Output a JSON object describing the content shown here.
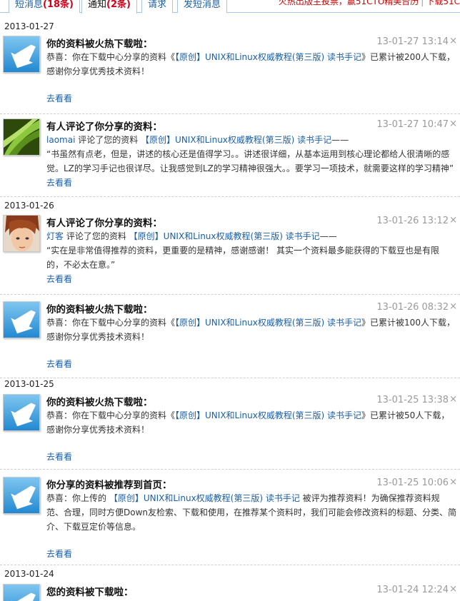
{
  "tabs": {
    "sms_label": "短消息",
    "sms_count": "(18条)",
    "notice_label": "通知",
    "notice_count": "(2条)",
    "request_label": "请求",
    "send_label": "发短消息"
  },
  "top_right": {
    "text1": "火热出版主投票，赢51CTO精美台历",
    "text2": "下载51C"
  },
  "colors": {
    "link": "#1a5fa8",
    "count": "#d0021b",
    "time": "#9a9a9a"
  },
  "dates": [
    "2013-01-27",
    "2013-01-26",
    "2013-01-25",
    "2013-01-24"
  ],
  "items": [
    {
      "avatar": "download-arrow-icon",
      "title": "你的资料被火热下载啦：",
      "time": "13-01-27 13:14",
      "close": "×",
      "body_pre": "恭喜：你在下载中心分享的资料《",
      "link": "【原创】UNIX和Linux权威教程(第三版) 读书手记",
      "body_post": "》已累计被200人下载，感谢你分享优秀技术资料！",
      "more": "去看看"
    },
    {
      "avatar": "green-leaf-avatar",
      "title": "有人评论了你分享的资料：",
      "time": "13-01-27 10:47",
      "close": "×",
      "user": "laomai",
      "action": " 评论了您的资料 ",
      "link": "【原创】UNIX和Linux权威教程(第三版) 读书手记",
      "dash": "——",
      "quote": "“书虽然有点老，但是，讲述的核心还是值得学习。。讲述很详细，从基本运用到核心理论都给人很清晰的感觉。LZ的学习手记也很详尽。让我感觉到LZ的学习精神很强大。。要学习一项技术，就需要这样的学习精神”",
      "more": "去看看"
    },
    {
      "avatar": "anime-face-avatar",
      "title": "有人评论了你分享的资料：",
      "time": "13-01-26 13:12",
      "close": "×",
      "user": "灯客",
      "action": " 评论了您的资料 ",
      "link": "【原创】UNIX和Linux权威教程(第三版) 读书手记",
      "dash": "——",
      "quote": "“实在是非常值得推荐的资料，更重要的是精神，感谢感谢！ 其实一个资料最多能获得的下载豆也是有限的，不必太在意。”",
      "more": "去看看"
    },
    {
      "avatar": "download-arrow-icon",
      "title": "你的资料被火热下载啦：",
      "time": "13-01-26 08:32",
      "close": "×",
      "body_pre": "恭喜：你在下载中心分享的资料《",
      "link": "【原创】UNIX和Linux权威教程(第三版) 读书手记",
      "body_post": "》已累计被100人下载，感谢你分享优秀技术资料！",
      "more": "去看看"
    },
    {
      "avatar": "download-arrow-icon",
      "title": "你的资料被火热下载啦：",
      "time": "13-01-25 13:38",
      "close": "×",
      "body_pre": "恭喜：你在下载中心分享的资料《",
      "link": "【原创】UNIX和Linux权威教程(第三版) 读书手记",
      "body_post": "》已累计被50人下载，感谢你分享优秀技术资料！",
      "more": "去看看"
    },
    {
      "avatar": "download-arrow-icon",
      "title": "你分享的资料被推荐到首页：",
      "time": "13-01-25 10:06",
      "close": "×",
      "body_pre": "恭喜：你上传的 ",
      "link": "【原创】UNIX和Linux权威教程(第三版) 读书手记",
      "body_post": " 被评为推荐资料！为确保推荐资料规范、合理，同时方便Down友检索、下载和使用，在推荐某个资料时，我们可能会修改资料的标题、分类、简介、下载豆定价等信息。",
      "more": "去看看"
    },
    {
      "avatar": "download-arrow-icon",
      "title": "您的资料被下载啦：",
      "time": "13-01-24 12:24",
      "close": "×"
    }
  ]
}
